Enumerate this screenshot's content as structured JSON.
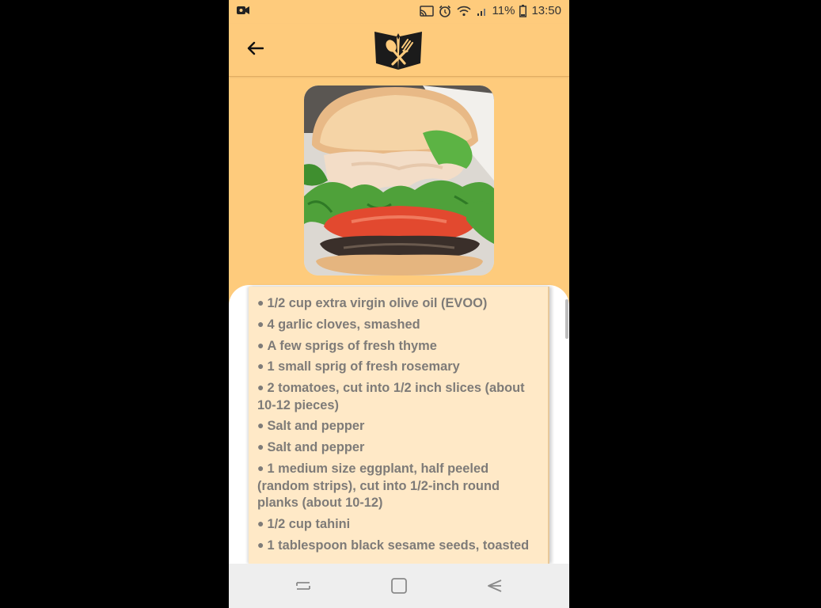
{
  "status_bar": {
    "battery_percent": "11%",
    "time": "13:50"
  },
  "app_bar": {
    "back_icon": "arrow-left-icon",
    "logo_icon": "cookbook-logo-icon"
  },
  "recipe": {
    "photo_icon": "burger-photo"
  },
  "ingredients": [
    "1/2 cup extra virgin olive oil (EVOO)",
    "4 garlic cloves, smashed",
    "A few sprigs of fresh thyme",
    "1 small sprig of fresh rosemary",
    "2 tomatoes, cut into 1/2 inch slices (about 10-12 pieces)",
    "Salt and pepper",
    "Salt and pepper",
    "1 medium size eggplant, half peeled (random strips), cut into 1/2-inch round planks (about 10-12)",
    "1/2 cup tahini",
    "1 tablespoon black sesame seeds, toasted"
  ],
  "bullet": "●",
  "nav_bar": {
    "recents_icon": "recents-icon",
    "home_icon": "home-icon",
    "back_icon": "back-triangle-icon"
  },
  "colors": {
    "header_bg": "#fecb7c",
    "card_bg": "#ffe9c7",
    "text": "#7e7b78"
  }
}
